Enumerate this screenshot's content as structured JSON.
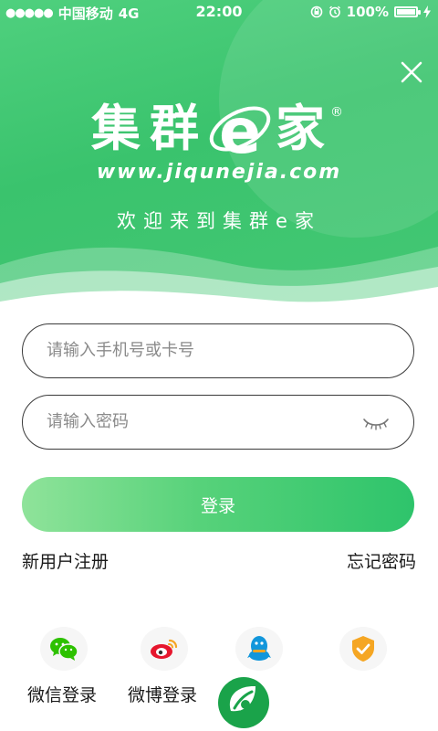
{
  "status_bar": {
    "signal_dots": "●●●●●",
    "carrier": "中国移动",
    "network": "4G",
    "time": "22:00",
    "battery_percent": "100%",
    "battery_level": 1.0
  },
  "brand": {
    "logo_chars": [
      "集",
      "群",
      "家"
    ],
    "logo_e": "e",
    "registered_mark": "®",
    "url": "www.jiqunejia.com",
    "welcome": "欢迎来到集群e家"
  },
  "form": {
    "phone_placeholder": "请输入手机号或卡号",
    "phone_value": "",
    "password_placeholder": "请输入密码",
    "password_value": "",
    "login_label": "登录"
  },
  "links": {
    "register": "新用户注册",
    "forgot": "忘记密码"
  },
  "social": [
    {
      "label": "微信登录",
      "icon": "wechat-icon"
    },
    {
      "label": "微博登录",
      "icon": "weibo-icon"
    },
    {
      "label": "",
      "icon": "qq-icon"
    },
    {
      "label": "",
      "icon": "shield-check-icon"
    }
  ],
  "colors": {
    "brand_green": "#3ac36d",
    "button_start": "#8fe39a",
    "button_end": "#2ec46b",
    "weibo_red": "#e6162d",
    "qq_blue": "#1296db",
    "shield_orange": "#f5a623"
  }
}
